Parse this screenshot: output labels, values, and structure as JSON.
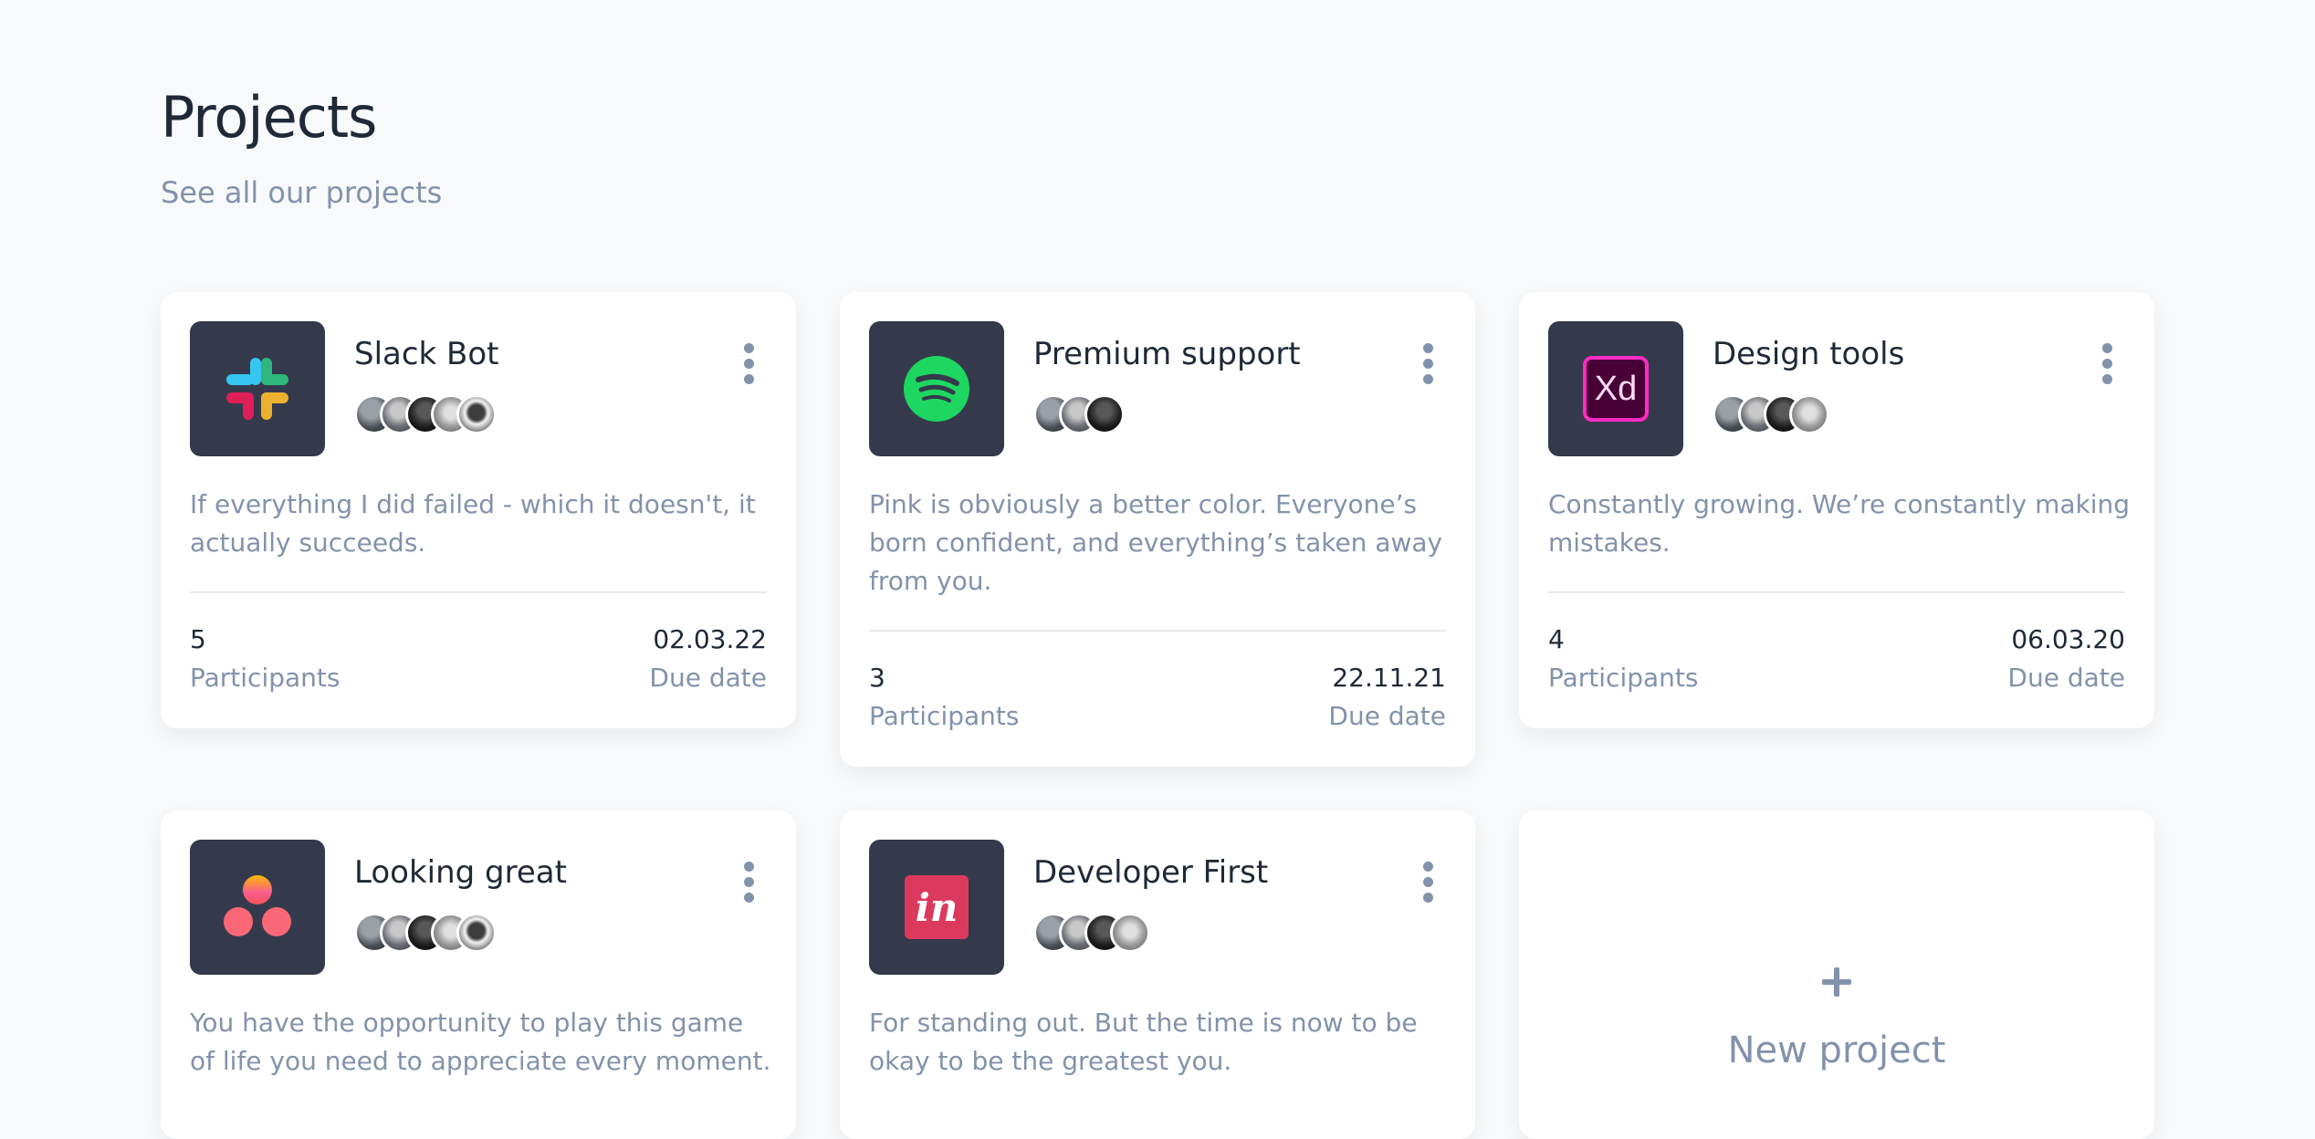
{
  "header": {
    "title": "Projects",
    "subtitle": "See all our projects"
  },
  "projects": [
    {
      "name": "Slack Bot",
      "icon": "slack-icon",
      "description": "If everything I did failed - which it doesn't, it actually succeeds.",
      "participants": "5",
      "participants_label": "Participants",
      "due_date": "02.03.22",
      "due_date_label": "Due date"
    },
    {
      "name": "Premium support",
      "icon": "spotify-icon",
      "description": "Pink is obviously a better color. Everyone’s born confident, and everything’s taken away from you.",
      "participants": "3",
      "participants_label": "Participants",
      "due_date": "22.11.21",
      "due_date_label": "Due date"
    },
    {
      "name": "Design tools",
      "icon": "adobe-xd-icon",
      "icon_text": "Xd",
      "description": "Constantly growing. We’re constantly making mistakes.",
      "participants": "4",
      "participants_label": "Participants",
      "due_date": "06.03.20",
      "due_date_label": "Due date"
    },
    {
      "name": "Looking great",
      "icon": "asana-icon",
      "description": "You have the opportunity to play this game of life you need to appreciate every moment."
    },
    {
      "name": "Developer First",
      "icon": "invision-icon",
      "icon_text": "in",
      "description": "For standing out. But the time is now to be okay to be the greatest you."
    }
  ],
  "new_project": {
    "label": "New project"
  },
  "colors": {
    "background": "#f8f9fa",
    "card": "#ffffff",
    "logo_box": "#343a4c",
    "text_dark": "#1f2937",
    "text_muted": "#8392ab"
  }
}
